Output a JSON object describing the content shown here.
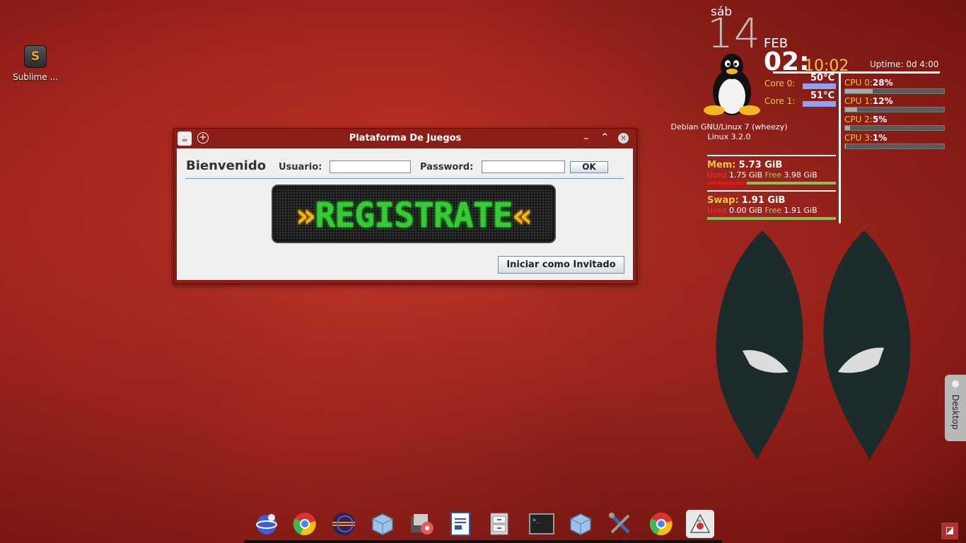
{
  "desktop": {
    "icons": [
      {
        "label": "Sublime ...",
        "icon": "sublime-text-icon"
      }
    ]
  },
  "clock": {
    "dow": "sáb",
    "day": "14",
    "month": "FEB",
    "hours": "02:",
    "minutes": "10:02",
    "uptime": "Uptime: 0d 4:00"
  },
  "system": {
    "distro": "Debian GNU/Linux 7 (wheezy)",
    "kernel": "Linux 3.2.0",
    "cores": [
      {
        "label": "Core 0:",
        "temp": "50°C"
      },
      {
        "label": "Core 1:",
        "temp": "51°C"
      }
    ],
    "cpus": [
      {
        "label": "CPU 0:",
        "pct": "28%",
        "value": 0.28
      },
      {
        "label": "CPU 1:",
        "pct": "12%",
        "value": 0.12
      },
      {
        "label": "CPU 2:",
        "pct": "5%",
        "value": 0.05
      },
      {
        "label": "CPU 3:",
        "pct": "1%",
        "value": 0.01
      }
    ],
    "mem": {
      "label": "Mem:",
      "total": "5.73 GiB",
      "used_label": "Used",
      "used": "1.75 GiB",
      "free_label": "Free",
      "free": "3.98 GiB",
      "used_fraction": 0.31
    },
    "swap": {
      "label": "Swap:",
      "total": "1.91 GiB",
      "used_label": "Used",
      "used": "0.00 GiB",
      "free_label": "Free",
      "free": "1.91 GiB",
      "used_fraction": 0.0
    }
  },
  "window": {
    "title": "Plataforma De Juegos",
    "welcome": "Bienvenido",
    "user_label": "Usuario:",
    "user_value": "",
    "password_label": "Password:",
    "password_value": "",
    "ok_label": "OK",
    "banner_left": "»",
    "banner_text": "REGISTRATE",
    "banner_right": "«",
    "guest_label": "Iniciar como Invitado"
  },
  "dock": {
    "items": [
      "browser-icon",
      "chrome-icon",
      "eclipse-icon",
      "virtualbox-icon",
      "media-icon",
      "writer-icon",
      "file-cabinet-icon",
      "terminal-icon",
      "virtualbox-icon",
      "tools-icon",
      "chrome-icon",
      "java-icon"
    ]
  },
  "desktop_tab": {
    "label": "Desktop"
  },
  "colors": {
    "window_frame": "#8d1d17",
    "accent_yellow": "#f0c24b",
    "led_green": "#37c937"
  }
}
